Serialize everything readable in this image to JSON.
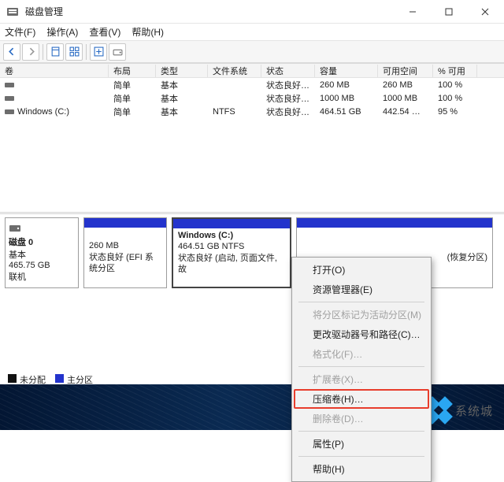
{
  "window": {
    "title": "磁盘管理"
  },
  "menubar": {
    "file": "文件(F)",
    "action": "操作(A)",
    "view": "查看(V)",
    "help": "帮助(H)"
  },
  "table": {
    "headers": {
      "volume": "卷",
      "layout": "布局",
      "type": "类型",
      "fs": "文件系统",
      "status": "状态",
      "capacity": "容量",
      "free": "可用空间",
      "pct": "% 可用"
    },
    "rows": [
      {
        "volume": "",
        "layout": "简单",
        "type": "基本",
        "fs": "",
        "status": "状态良好 (…",
        "capacity": "260 MB",
        "free": "260 MB",
        "pct": "100 %"
      },
      {
        "volume": "",
        "layout": "简单",
        "type": "基本",
        "fs": "",
        "status": "状态良好 (…",
        "capacity": "1000 MB",
        "free": "1000 MB",
        "pct": "100 %"
      },
      {
        "volume": "Windows (C:)",
        "layout": "简单",
        "type": "基本",
        "fs": "NTFS",
        "status": "状态良好 (…",
        "capacity": "464.51 GB",
        "free": "442.54 …",
        "pct": "95 %"
      }
    ]
  },
  "disk": {
    "head": {
      "name": "磁盘 0",
      "type": "基本",
      "size": "465.75 GB",
      "status": "联机"
    },
    "p260": {
      "size": "260 MB",
      "status": "状态良好 (EFI 系统分区"
    },
    "pwin": {
      "title": "Windows  (C:)",
      "size": "464.51 GB NTFS",
      "status": "状态良好 (启动, 页面文件, 故"
    },
    "precov": {
      "status": "(恢复分区)"
    }
  },
  "legend": {
    "unalloc": "未分配",
    "primary": "主分区"
  },
  "context": {
    "open": "打开(O)",
    "explorer": "资源管理器(E)",
    "markactive": "将分区标记为活动分区(M)",
    "changedrive": "更改驱动器号和路径(C)…",
    "format": "格式化(F)…",
    "extend": "扩展卷(X)…",
    "shrink": "压缩卷(H)…",
    "delete": "删除卷(D)…",
    "props": "属性(P)",
    "help": "帮助(H)"
  },
  "watermark": "系统城"
}
